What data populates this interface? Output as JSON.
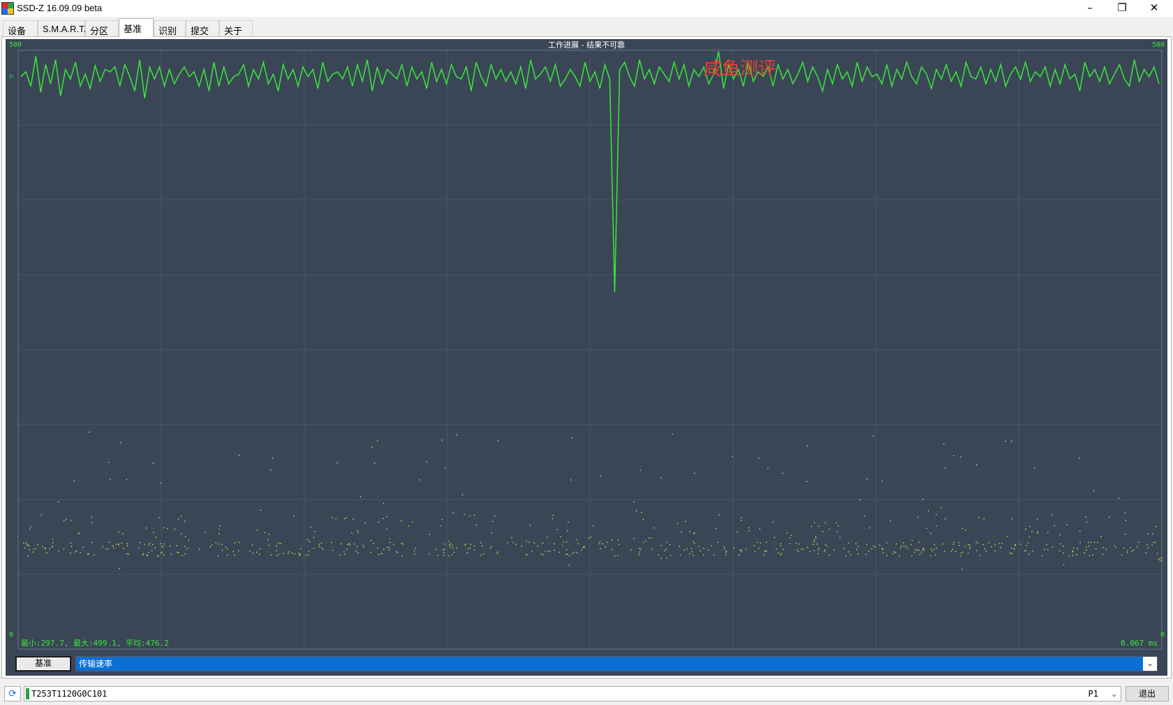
{
  "window": {
    "title": "SSD-Z 16.09.09 beta",
    "minimize_glyph": "–",
    "restore_glyph": "❐",
    "close_glyph": "✕"
  },
  "tabs": [
    {
      "label": "设备"
    },
    {
      "label": "S.M.A.R.T."
    },
    {
      "label": "分区"
    },
    {
      "label": "基准",
      "active": true
    },
    {
      "label": "识别"
    },
    {
      "label": "提交"
    },
    {
      "label": "关于"
    }
  ],
  "chart": {
    "title": "工作进展 - 结果不可靠",
    "watermark": "咸鱼测评",
    "y_max_label": "500",
    "y_min_label": "0",
    "stats_label": "最小:297.7, 最大:499.1, 平均:476.2",
    "latency_label": "0.067 ms",
    "left_marker": "▷",
    "right_marker": "◁",
    "colors": {
      "background": "#3a4656",
      "line": "#39e839",
      "dots": "#d6e84a",
      "grid": "#4a5666"
    }
  },
  "chart_data": {
    "type": "line",
    "ylim": [
      0,
      500
    ],
    "series": [
      {
        "values": [
          478,
          482,
          470,
          495,
          465,
          488,
          472,
          492,
          462,
          484,
          476,
          490,
          470,
          480,
          468,
          487,
          474,
          484,
          482,
          486,
          470,
          488,
          478,
          466,
          492,
          460,
          486,
          476,
          486,
          470,
          484,
          472,
          480,
          486,
          478,
          482,
          470,
          484,
          466,
          490,
          470,
          486,
          472,
          478,
          480,
          488,
          470,
          484,
          476,
          490,
          472,
          480,
          466,
          488,
          476,
          484,
          470,
          486,
          478,
          484,
          468,
          490,
          474,
          480,
          482,
          476,
          486,
          470,
          488,
          474,
          492,
          466,
          486,
          472,
          484,
          480,
          476,
          488,
          470,
          486,
          476,
          482,
          468,
          490,
          474,
          484,
          472,
          488,
          478,
          476,
          486,
          466,
          490,
          478,
          470,
          488,
          476,
          484,
          474,
          482,
          472,
          486,
          468,
          492,
          476,
          480,
          486,
          474,
          488,
          470,
          476,
          484,
          478,
          470,
          490,
          474,
          482,
          468,
          488,
          476,
          298,
          484,
          490,
          478,
          470,
          492,
          476,
          484,
          472,
          486,
          480,
          474,
          490,
          476,
          488,
          470,
          484,
          478,
          486,
          472,
          480,
          499,
          468,
          488,
          476,
          484,
          470,
          490,
          474,
          482,
          478,
          486,
          470,
          488,
          476,
          484,
          472,
          480,
          490,
          474,
          486,
          478,
          466,
          484,
          472,
          488,
          476,
          482,
          470,
          490,
          474,
          486,
          478,
          480,
          472,
          488,
          470,
          484,
          476,
          490,
          478,
          472,
          486,
          480,
          468,
          484,
          476,
          488,
          474,
          482,
          470,
          490,
          478,
          476,
          486,
          472,
          484,
          474,
          488,
          470,
          480,
          486,
          476,
          490,
          474,
          482,
          478,
          486,
          470,
          484,
          472,
          488,
          476,
          480,
          466,
          490,
          478,
          484,
          474,
          486,
          472,
          480,
          488,
          476,
          470,
          492,
          474,
          484,
          478,
          486,
          472
        ]
      }
    ]
  },
  "controls": {
    "bench_button_label": "基准",
    "metric_selected": "传输速率",
    "metric_arrow": "⌄"
  },
  "status": {
    "refresh_glyph": "⟳",
    "drive_name": "T253T1120G0C101",
    "port": "P1",
    "port_arrow": "⌄",
    "exit_label": "退出"
  }
}
